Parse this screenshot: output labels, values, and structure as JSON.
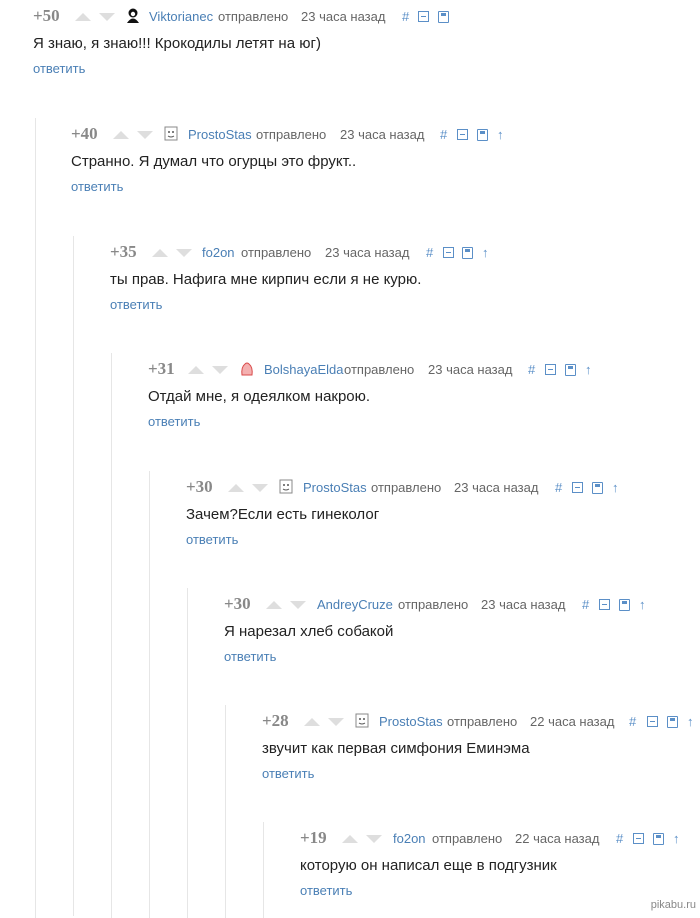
{
  "labels": {
    "sent": "отправлено",
    "reply": "ответить",
    "anchor": "#",
    "parent": "↑"
  },
  "comments": [
    {
      "rating": "+50",
      "author": "Viktorianec",
      "time": "23 часа назад",
      "text": "Я знаю, я знаю!!! Крокодилы летят на юг)",
      "avatar": "dark-head-icon"
    },
    {
      "rating": "+40",
      "author": "ProstoStas",
      "time": "23 часа назад",
      "text": "Странно. Я думал что огурцы это фрукт..",
      "avatar": "face-icon"
    },
    {
      "rating": "+35",
      "author": "fo2on",
      "time": "23 часа назад",
      "text": "ты прав. Нафига мне кирпич если я не курю.",
      "avatar": ""
    },
    {
      "rating": "+31",
      "author": "BolshayaElda",
      "time": "23 часа назад",
      "text": "Отдай мне, я одеялком накрою.",
      "avatar": "red-figure-icon"
    },
    {
      "rating": "+30",
      "author": "ProstoStas",
      "time": "23 часа назад",
      "text": "Зачем?Если есть гинеколог",
      "avatar": "face-icon"
    },
    {
      "rating": "+30",
      "author": "AndreyCruze",
      "time": "23 часа назад",
      "text": "Я нарезал хлеб собакой",
      "avatar": ""
    },
    {
      "rating": "+28",
      "author": "ProstoStas",
      "time": "22 часа назад",
      "text": "звучит как первая симфония Еминэма",
      "avatar": "face-icon"
    },
    {
      "rating": "+19",
      "author": "fo2on",
      "time": "22 часа назад",
      "text": "которую он написал еще в подгузник",
      "avatar": ""
    }
  ],
  "watermark": "pikabu.ru"
}
